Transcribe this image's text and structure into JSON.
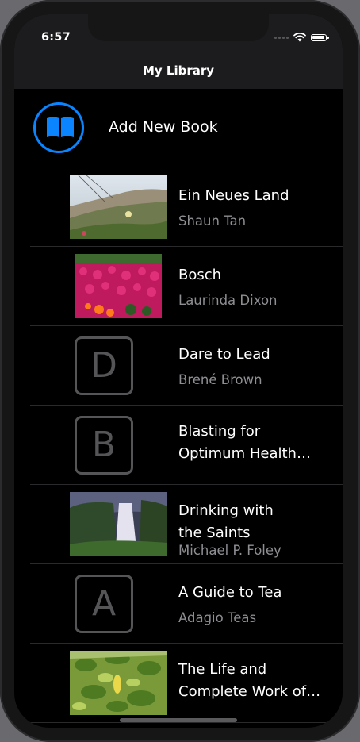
{
  "status": {
    "time": "6:57"
  },
  "nav": {
    "title": "My Library"
  },
  "add_book": {
    "label": "Add New Book",
    "icon": "book-icon",
    "accent": "#0a84ff"
  },
  "books": [
    {
      "title": "Ein Neues Land",
      "author": "Shaun Tan",
      "cover": "photo-dunes"
    },
    {
      "title": "Bosch",
      "author": "Laurinda Dixon",
      "cover": "photo-flowers"
    },
    {
      "title": "Dare to Lead",
      "author": "Brené Brown",
      "cover_letter": "D"
    },
    {
      "title_line1": "Blasting for",
      "title_line2": "Optimum Health…",
      "author": "",
      "cover_letter": "B"
    },
    {
      "title_line1": "Drinking with",
      "title_line2": "the Saints",
      "author": "Michael P. Foley",
      "cover": "photo-waterfall"
    },
    {
      "title": "A Guide to Tea",
      "author": "Adagio Teas",
      "cover_letter": "A"
    },
    {
      "title_line1": "The Life and",
      "title_line2": "Complete Work of…",
      "author": "",
      "cover": "photo-leaves"
    }
  ]
}
